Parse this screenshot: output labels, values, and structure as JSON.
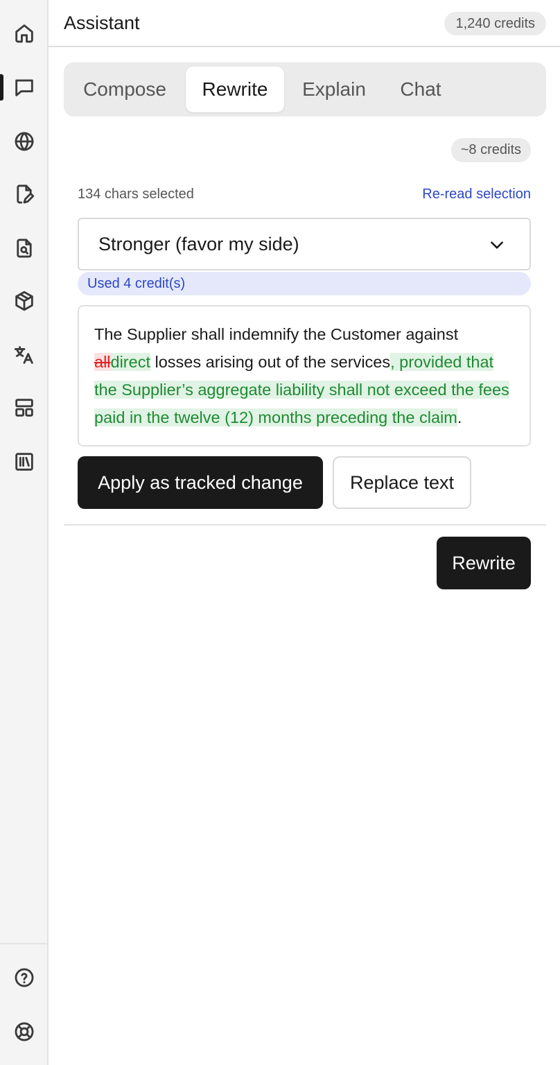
{
  "header": {
    "title": "Assistant",
    "credits": "1,240 credits"
  },
  "sidebar": {
    "items": [
      {
        "icon": "home-icon"
      },
      {
        "icon": "chat-icon",
        "active": true
      },
      {
        "icon": "globe-icon"
      },
      {
        "icon": "document-edit-icon"
      },
      {
        "icon": "document-search-icon"
      },
      {
        "icon": "cube-icon"
      },
      {
        "icon": "translate-icon"
      },
      {
        "icon": "layout-icon"
      },
      {
        "icon": "library-icon"
      }
    ],
    "bottom_items": [
      {
        "icon": "help-icon"
      },
      {
        "icon": "support-icon"
      }
    ]
  },
  "tabs": [
    {
      "label": "Compose"
    },
    {
      "label": "Rewrite",
      "active": true
    },
    {
      "label": "Explain"
    },
    {
      "label": "Chat"
    }
  ],
  "rewrite": {
    "cost": "~8 credits",
    "selection_count": "134 chars selected",
    "reread_label": "Re-read selection",
    "mode": "Stronger (favor my side)",
    "used_note": "Used 4 credit(s)",
    "result": {
      "t1": "The Supplier shall indemnify the Customer against ",
      "del1": "all",
      "ins1": "direct",
      "t2": " losses arising out of the services",
      "ins2": ", provided that the Supplier’s aggregate liability shall not exceed the fees paid in the twelve (12) months preceding the claim",
      "t3": "."
    },
    "apply_label": "Apply as tracked change",
    "replace_label": "Replace text",
    "rewrite_label": "Rewrite"
  },
  "colors": {
    "accent_blue": "#2d47c6",
    "insert_green": "#1f8a34",
    "delete_red": "#e02020",
    "primary_button": "#1a1a1a"
  }
}
